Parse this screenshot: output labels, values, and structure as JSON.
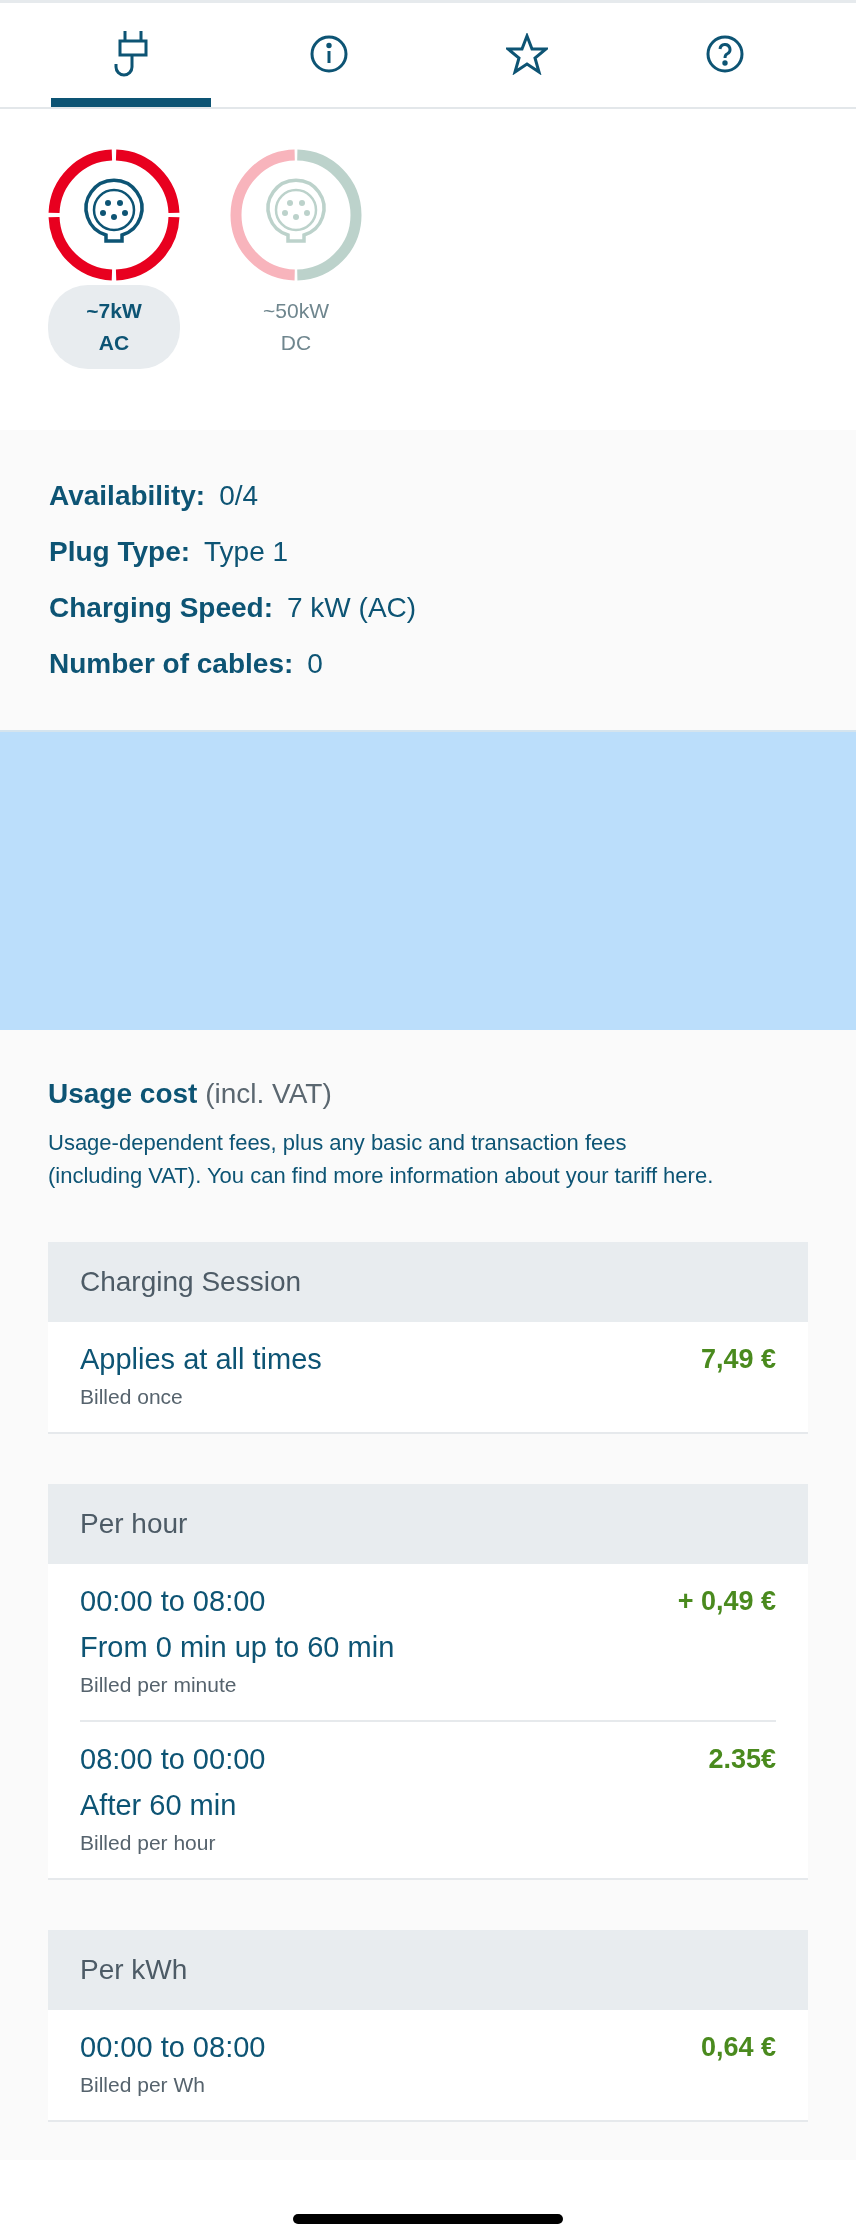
{
  "tabs": [
    {
      "kind": "plug",
      "selected": true
    },
    {
      "kind": "info",
      "selected": false
    },
    {
      "kind": "star",
      "selected": false
    },
    {
      "kind": "help",
      "selected": false
    }
  ],
  "connectors": [
    {
      "power": "~7kW",
      "current": "AC",
      "selected": true,
      "ports": [
        {
          "color": "#e8001f"
        },
        {
          "color": "#e8001f"
        },
        {
          "color": "#e8001f"
        },
        {
          "color": "#e8001f"
        }
      ]
    },
    {
      "power": "~50kW",
      "current": "DC",
      "selected": false,
      "ports": [
        {
          "color": "#bcd2cb"
        },
        {
          "color": "#f8b4bc"
        }
      ]
    }
  ],
  "details": [
    {
      "label": "Availability:",
      "value": "0/4"
    },
    {
      "label": "Plug Type:",
      "value": "Type 1"
    },
    {
      "label": "Charging Speed:",
      "value": "7 kW (AC)"
    },
    {
      "label": "Number of cables:",
      "value": "0"
    }
  ],
  "usage_cost": {
    "title": "**Usage cost** (incl. VAT)",
    "description": "Usage-dependent fees, plus any basic and transaction fees (including VAT). You can find more information about your tariff here."
  },
  "tariffs": [
    {
      "title": "Charging Session",
      "rows": [
        {
          "lines": [
            "Applies at all times"
          ],
          "note": "Billed once",
          "price": "7,49 €"
        }
      ]
    },
    {
      "title": "Per hour",
      "rows": [
        {
          "lines": [
            "00:00 to 08:00",
            "From 0 min up to 60 min"
          ],
          "note": "Billed per minute",
          "price": "+ 0,49 €"
        },
        {
          "lines": [
            "08:00 to 00:00",
            "After 60 min"
          ],
          "note": "Billed per hour",
          "price": "2.35€"
        }
      ]
    },
    {
      "title": "Per kWh",
      "rows": [
        {
          "lines": [
            "00:00 to 08:00"
          ],
          "note": "Billed per Wh",
          "price": "0,64 €"
        }
      ]
    }
  ]
}
